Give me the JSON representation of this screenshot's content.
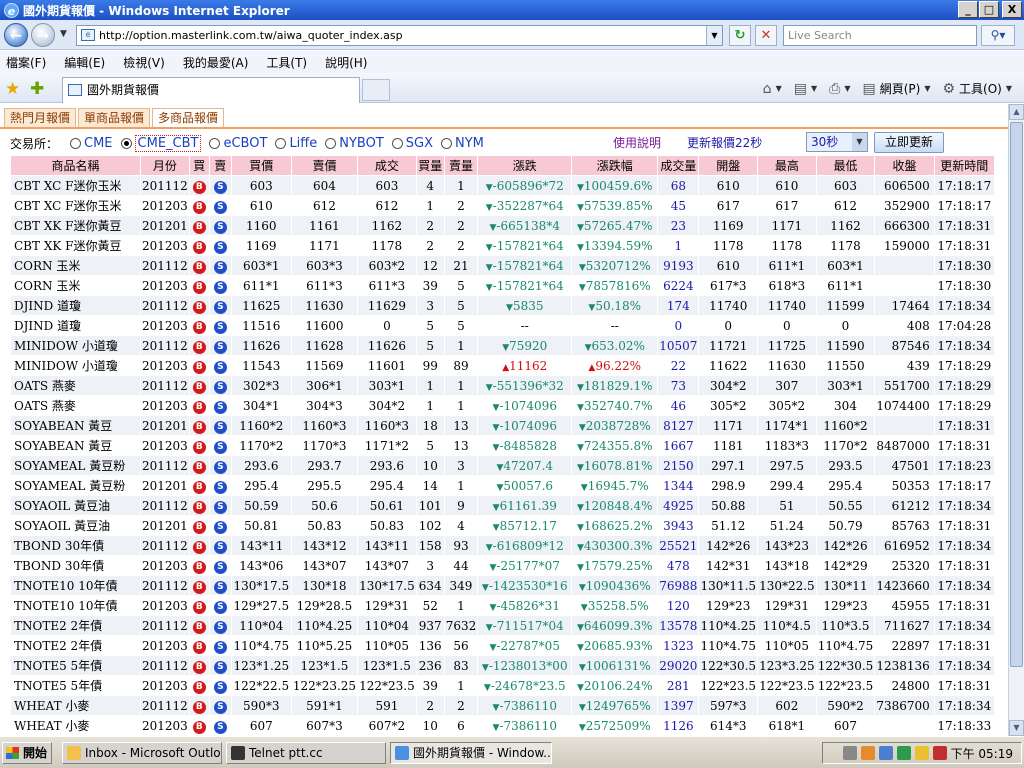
{
  "window": {
    "title": "國外期貨報價 - Windows Internet Explorer",
    "min_label": "_",
    "max_label": "□",
    "close_label": "X"
  },
  "address": {
    "url": "http://option.masterlink.com.tw/aiwa_quoter_index.asp",
    "search_placeholder": "Live Search"
  },
  "menu": [
    "檔案(F)",
    "編輯(E)",
    "檢視(V)",
    "我的最愛(A)",
    "工具(T)",
    "說明(H)"
  ],
  "tab": {
    "title": "國外期貨報價"
  },
  "command_bar": {
    "page_label": "網頁(P)",
    "tools_label": "工具(O)"
  },
  "site_tabs": [
    "熱門月報價",
    "單商品報價",
    "多商品報價"
  ],
  "filter": {
    "exchange_label": "交易所：",
    "exchanges": [
      "CME",
      "CME_CBT",
      "eCBOT",
      "Liffe",
      "NYBOT",
      "SGX",
      "NYM"
    ],
    "selected_exchange": "CME_CBT",
    "help_label": "使用說明",
    "refresh_info": "更新報價22秒",
    "interval_value": "30秒",
    "update_button": "立即更新"
  },
  "table": {
    "headers": [
      "商品名稱",
      "月份",
      "買",
      "賣",
      "買價",
      "賣價",
      "成交",
      "買量",
      "賣量",
      "漲跌",
      "漲跌幅",
      "成交量",
      "開盤",
      "最高",
      "最低",
      "收盤",
      "更新時間"
    ],
    "buy_label": "B",
    "sell_label": "S",
    "rows": [
      [
        "CBT XC F迷你玉米",
        "201112",
        "603",
        "604",
        "603",
        "4",
        "1",
        "-605896*72",
        "down",
        "100459.6%",
        "down",
        "68",
        "610",
        "610",
        "603",
        "606500",
        "17:18:17"
      ],
      [
        "CBT XC F迷你玉米",
        "201203",
        "610",
        "612",
        "612",
        "1",
        "2",
        "-352287*64",
        "down",
        "57539.85%",
        "down",
        "45",
        "617",
        "617",
        "612",
        "352900",
        "17:18:17"
      ],
      [
        "CBT XK F迷你黃豆",
        "201201",
        "1160",
        "1161",
        "1162",
        "2",
        "2",
        "-665138*4",
        "down",
        "57265.47%",
        "down",
        "23",
        "1169",
        "1171",
        "1162",
        "666300",
        "17:18:31"
      ],
      [
        "CBT XK F迷你黃豆",
        "201203",
        "1169",
        "1171",
        "1178",
        "2",
        "2",
        "-157821*64",
        "down",
        "13394.59%",
        "down",
        "1",
        "1178",
        "1178",
        "1178",
        "159000",
        "17:18:31"
      ],
      [
        "CORN 玉米",
        "201112",
        "603*1",
        "603*3",
        "603*2",
        "12",
        "21",
        "-157821*64",
        "down",
        "5320712%",
        "down",
        "9193",
        "610",
        "611*1",
        "603*1",
        "",
        "17:18:30"
      ],
      [
        "CORN 玉米",
        "201203",
        "611*1",
        "611*3",
        "611*3",
        "39",
        "5",
        "-157821*64",
        "down",
        "7857816%",
        "down",
        "6224",
        "617*3",
        "618*3",
        "611*1",
        "",
        "17:18:30"
      ],
      [
        "DJIND 道瓊",
        "201112",
        "11625",
        "11630",
        "11629",
        "3",
        "5",
        "5835",
        "down",
        "50.18%",
        "down",
        "174",
        "11740",
        "11740",
        "11599",
        "17464",
        "17:18:34"
      ],
      [
        "DJIND 道瓊",
        "201203",
        "11516",
        "11600",
        "0",
        "5",
        "5",
        "--",
        "none",
        "--",
        "none",
        "0",
        "0",
        "0",
        "0",
        "408",
        "17:04:28"
      ],
      [
        "MINIDOW 小道瓊",
        "201112",
        "11626",
        "11628",
        "11626",
        "5",
        "1",
        "75920",
        "down",
        "653.02%",
        "down",
        "10507",
        "11721",
        "11725",
        "11590",
        "87546",
        "17:18:34"
      ],
      [
        "MINIDOW 小道瓊",
        "201203",
        "11543",
        "11569",
        "11601",
        "99",
        "89",
        "11162",
        "up",
        "96.22%",
        "up",
        "22",
        "11622",
        "11630",
        "11550",
        "439",
        "17:18:29"
      ],
      [
        "OATS 燕麥",
        "201112",
        "302*3",
        "306*1",
        "303*1",
        "1",
        "1",
        "-551396*32",
        "down",
        "181829.1%",
        "down",
        "73",
        "304*2",
        "307",
        "303*1",
        "551700",
        "17:18:29"
      ],
      [
        "OATS 燕麥",
        "201203",
        "304*1",
        "304*3",
        "304*2",
        "1",
        "1",
        "-1074096",
        "down",
        "352740.7%",
        "down",
        "46",
        "305*2",
        "305*2",
        "304",
        "1074400",
        "17:18:29"
      ],
      [
        "SOYABEAN 黃豆",
        "201201",
        "1160*2",
        "1160*3",
        "1160*3",
        "18",
        "13",
        "-1074096",
        "down",
        "2038728%",
        "down",
        "8127",
        "1171",
        "1174*1",
        "1160*2",
        "",
        "17:18:31"
      ],
      [
        "SOYABEAN 黃豆",
        "201203",
        "1170*2",
        "1170*3",
        "1171*2",
        "5",
        "13",
        "-8485828",
        "down",
        "724355.8%",
        "down",
        "1667",
        "1181",
        "1183*3",
        "1170*2",
        "8487000",
        "17:18:31"
      ],
      [
        "SOYAMEAL 黃豆粉",
        "201112",
        "293.6",
        "293.7",
        "293.6",
        "10",
        "3",
        "47207.4",
        "down",
        "16078.81%",
        "down",
        "2150",
        "297.1",
        "297.5",
        "293.5",
        "47501",
        "17:18:23"
      ],
      [
        "SOYAMEAL 黃豆粉",
        "201201",
        "295.4",
        "295.5",
        "295.4",
        "14",
        "1",
        "50057.6",
        "down",
        "16945.7%",
        "down",
        "1344",
        "298.9",
        "299.4",
        "295.4",
        "50353",
        "17:18:17"
      ],
      [
        "SOYAOIL 黃豆油",
        "201112",
        "50.59",
        "50.6",
        "50.61",
        "101",
        "9",
        "61161.39",
        "down",
        "120848.4%",
        "down",
        "4925",
        "50.88",
        "51",
        "50.55",
        "61212",
        "17:18:34"
      ],
      [
        "SOYAOIL 黃豆油",
        "201201",
        "50.81",
        "50.83",
        "50.83",
        "102",
        "4",
        "85712.17",
        "down",
        "168625.2%",
        "down",
        "3943",
        "51.12",
        "51.24",
        "50.79",
        "85763",
        "17:18:31"
      ],
      [
        "TBOND 30年債",
        "201112",
        "143*11",
        "143*12",
        "143*11",
        "158",
        "93",
        "-616809*12",
        "down",
        "430300.3%",
        "down",
        "25521",
        "142*26",
        "143*23",
        "142*26",
        "616952",
        "17:18:34"
      ],
      [
        "TBOND 30年債",
        "201203",
        "143*06",
        "143*07",
        "143*07",
        "3",
        "44",
        "-25177*07",
        "down",
        "17579.25%",
        "down",
        "478",
        "142*31",
        "143*18",
        "142*29",
        "25320",
        "17:18:31"
      ],
      [
        "TNOTE10 10年債",
        "201112",
        "130*17.5",
        "130*18",
        "130*17.5",
        "634",
        "349",
        "-1423530*16",
        "down",
        "1090436%",
        "down",
        "76988",
        "130*11.5",
        "130*22.5",
        "130*11",
        "1423660",
        "17:18:34"
      ],
      [
        "TNOTE10 10年債",
        "201203",
        "129*27.5",
        "129*28.5",
        "129*31",
        "52",
        "1",
        "-45826*31",
        "down",
        "35258.5%",
        "down",
        "120",
        "129*23",
        "129*31",
        "129*23",
        "45955",
        "17:18:31"
      ],
      [
        "TNOTE2 2年債",
        "201112",
        "110*04",
        "110*4.25",
        "110*04",
        "937",
        "7632",
        "-711517*04",
        "down",
        "646099.3%",
        "down",
        "13578",
        "110*4.25",
        "110*4.5",
        "110*3.5",
        "711627",
        "17:18:34"
      ],
      [
        "TNOTE2 2年債",
        "201203",
        "110*4.75",
        "110*5.25",
        "110*05",
        "136",
        "56",
        "-22787*05",
        "down",
        "20685.93%",
        "down",
        "1323",
        "110*4.75",
        "110*05",
        "110*4.75",
        "22897",
        "17:18:31"
      ],
      [
        "TNOTE5 5年債",
        "201112",
        "123*1.25",
        "123*1.5",
        "123*1.5",
        "236",
        "83",
        "-1238013*00",
        "down",
        "1006131%",
        "down",
        "29020",
        "122*30.5",
        "123*3.25",
        "122*30.5",
        "1238136",
        "17:18:34"
      ],
      [
        "TNOTE5 5年債",
        "201203",
        "122*22.5",
        "122*23.25",
        "122*23.5",
        "39",
        "1",
        "-24678*23.5",
        "down",
        "20106.24%",
        "down",
        "281",
        "122*23.5",
        "122*23.5",
        "122*23.5",
        "24800",
        "17:18:31"
      ],
      [
        "WHEAT 小麥",
        "201112",
        "590*3",
        "591*1",
        "591",
        "2",
        "2",
        "-7386110",
        "down",
        "1249765%",
        "down",
        "1397",
        "597*3",
        "602",
        "590*2",
        "7386700",
        "17:18:34"
      ],
      [
        "WHEAT 小麥",
        "201203",
        "607",
        "607*3",
        "607*2",
        "10",
        "6",
        "-7386110",
        "down",
        "2572509%",
        "down",
        "1126",
        "614*3",
        "618*1",
        "607",
        "",
        "17:18:33"
      ]
    ]
  },
  "taskbar": {
    "start_label": "開始",
    "tasks": [
      "Inbox - Microsoft Outlook",
      "Telnet ptt.cc",
      "國外期貨報價 - Window..."
    ],
    "clock": "下午 05:19"
  },
  "colors": {
    "header_bg": "#f6c9d5",
    "down": "#1a8a6a",
    "up": "#d01010",
    "volume": "#1a1aa8"
  }
}
